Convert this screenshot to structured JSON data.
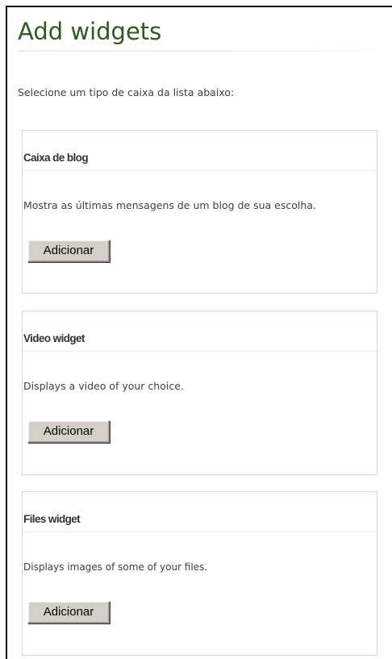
{
  "page": {
    "title": "Add widgets",
    "intro": "Selecione um tipo de caixa da lista abaixo:"
  },
  "widgets": [
    {
      "title": "Caixa de blog",
      "description": "Mostra as últimas mensagens de um blog de sua escolha.",
      "button_label": "Adicionar"
    },
    {
      "title": "Video widget",
      "description": "Displays a video of your choice.",
      "button_label": "Adicionar"
    },
    {
      "title": "Files widget",
      "description": "Displays images of some of your files.",
      "button_label": "Adicionar"
    }
  ],
  "colors": {
    "title": "#2f5a1f",
    "card_border": "#c9dbe8",
    "button_face": "#d4d0c8"
  }
}
